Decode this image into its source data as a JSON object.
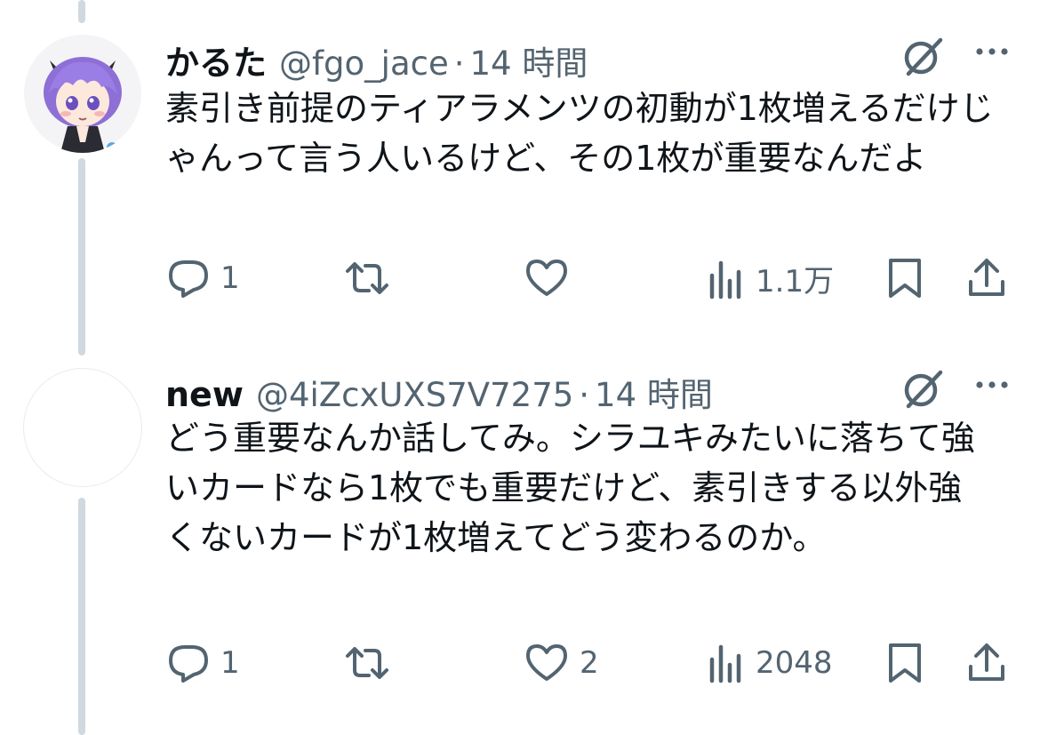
{
  "tweets": [
    {
      "display_name": "かるた",
      "handle": "@fgo_jace",
      "separator": "·",
      "time": "14 時間",
      "text": "素引き前提のティアラメンツの初動が1枚増えるだけじゃんって言う人いるけど、その1枚が重要なんだよ",
      "avatar_icon": "anime-girl-avatar",
      "actions": {
        "replies": "1",
        "retweets": "",
        "likes": "",
        "views": "1.1万"
      }
    },
    {
      "display_name": "new",
      "handle": "@4iZcxUXS7V7275",
      "separator": "·",
      "time": "14 時間",
      "text": "どう重要なんか話してみ。シラユキみたいに落ちて強いカードなら1枚でも重要だけど、素引きする以外強くないカードが1枚増えてどう変わるのか。",
      "avatar_icon": "blank-avatar",
      "actions": {
        "replies": "1",
        "retweets": "",
        "likes": "2",
        "views": "2048"
      }
    }
  ],
  "icons": [
    "reply-icon",
    "retweet-icon",
    "like-icon",
    "views-icon",
    "bookmark-icon",
    "share-icon",
    "grok-icon",
    "more-icon"
  ],
  "colors": {
    "text": "#0f1419",
    "secondary": "#536471",
    "thread_line": "#cfd9de"
  }
}
